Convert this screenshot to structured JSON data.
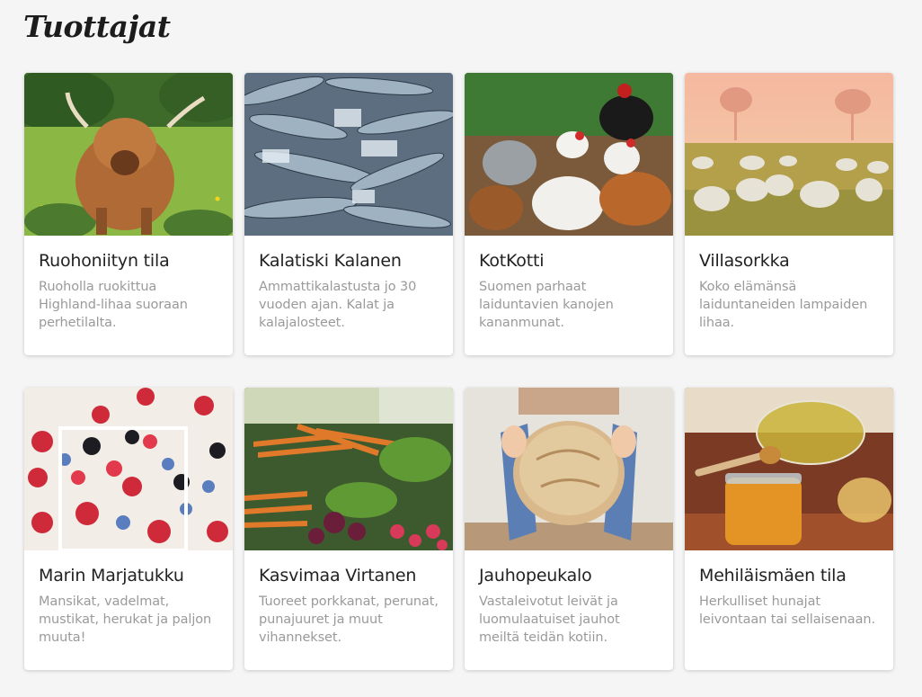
{
  "page": {
    "title": "Tuottajat"
  },
  "producers": [
    {
      "name": "Ruohoniityn tila",
      "description": "Ruoholla ruokittua Highland-lihaa suoraan perhetilalta."
    },
    {
      "name": "Kalatiski Kalanen",
      "description": "Ammattikalastusta jo 30 vuoden ajan. Kalat ja kalajalosteet."
    },
    {
      "name": "KotKotti",
      "description": "Suomen parhaat laiduntavien kanojen kananmunat."
    },
    {
      "name": "Villasorkka",
      "description": "Koko elämänsä laiduntaneiden lampaiden lihaa."
    },
    {
      "name": "Marin Marjatukku",
      "description": "Mansikat, vadelmat, mustikat, herukat ja paljon muuta!"
    },
    {
      "name": "Kasvimaa Virtanen",
      "description": "Tuoreet porkkanat, perunat, punajuuret ja muut vihannekset."
    },
    {
      "name": "Jauhopeukalo",
      "description": "Vastaleivotut leivät ja luomulaatuiset jauhot meiltä teidän kotiin."
    },
    {
      "name": "Mehiläismäen tila",
      "description": "Herkulliset hunajat leivontaan tai sellaisenaan."
    }
  ]
}
